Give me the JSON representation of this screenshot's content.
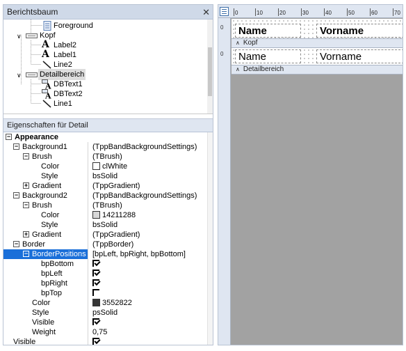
{
  "report_tree": {
    "title": "Berichtsbaum",
    "nodes": [
      {
        "label": "Foreground"
      },
      {
        "label": "Kopf"
      },
      {
        "label": "Label2"
      },
      {
        "label": "Label1"
      },
      {
        "label": "Line2"
      },
      {
        "label": "Detailbereich"
      },
      {
        "label": "DBText1"
      },
      {
        "label": "DBText2"
      },
      {
        "label": "Line1"
      }
    ]
  },
  "properties": {
    "title": "Eigenschaften für Detail",
    "rows": [
      {
        "name": "Appearance",
        "value": ""
      },
      {
        "name": "Background1",
        "value": "(TppBandBackgroundSettings)"
      },
      {
        "name": "Brush",
        "value": "(TBrush)"
      },
      {
        "name": "Color",
        "value": "clWhite",
        "swatch": "#ffffff"
      },
      {
        "name": "Style",
        "value": "bsSolid"
      },
      {
        "name": "Gradient",
        "value": "(TppGradient)"
      },
      {
        "name": "Background2",
        "value": "(TppBandBackgroundSettings)"
      },
      {
        "name": "Brush",
        "value": "(TBrush)"
      },
      {
        "name": "Color",
        "value": "14211288",
        "swatch": "#d8d8d8"
      },
      {
        "name": "Style",
        "value": "bsSolid"
      },
      {
        "name": "Gradient",
        "value": "(TppGradient)"
      },
      {
        "name": "Border",
        "value": "(TppBorder)"
      },
      {
        "name": "BorderPositions",
        "value": "[bpLeft, bpRight, bpBottom]"
      },
      {
        "name": "bpBottom",
        "value": "",
        "checked": true
      },
      {
        "name": "bpLeft",
        "value": "",
        "checked": true
      },
      {
        "name": "bpRight",
        "value": "",
        "checked": true
      },
      {
        "name": "bpTop",
        "value": "",
        "checked": false
      },
      {
        "name": "Color",
        "value": "3552822",
        "swatch": "#363636"
      },
      {
        "name": "Style",
        "value": "psSolid"
      },
      {
        "name": "Visible",
        "value": "",
        "checked": true
      },
      {
        "name": "Weight",
        "value": "0,75"
      },
      {
        "name": "Visible",
        "value": "",
        "checked": true
      }
    ]
  },
  "designer": {
    "ruler_ticks": [
      "0",
      "10",
      "20",
      "30",
      "40",
      "50",
      "60",
      "70"
    ],
    "header_band": {
      "label": "Kopf",
      "col1": "Name",
      "col2": "Vorname"
    },
    "detail_band": {
      "label": "Detailbereich",
      "col1": "Name",
      "col2": "Vorname"
    },
    "vruler_mark": "0"
  }
}
